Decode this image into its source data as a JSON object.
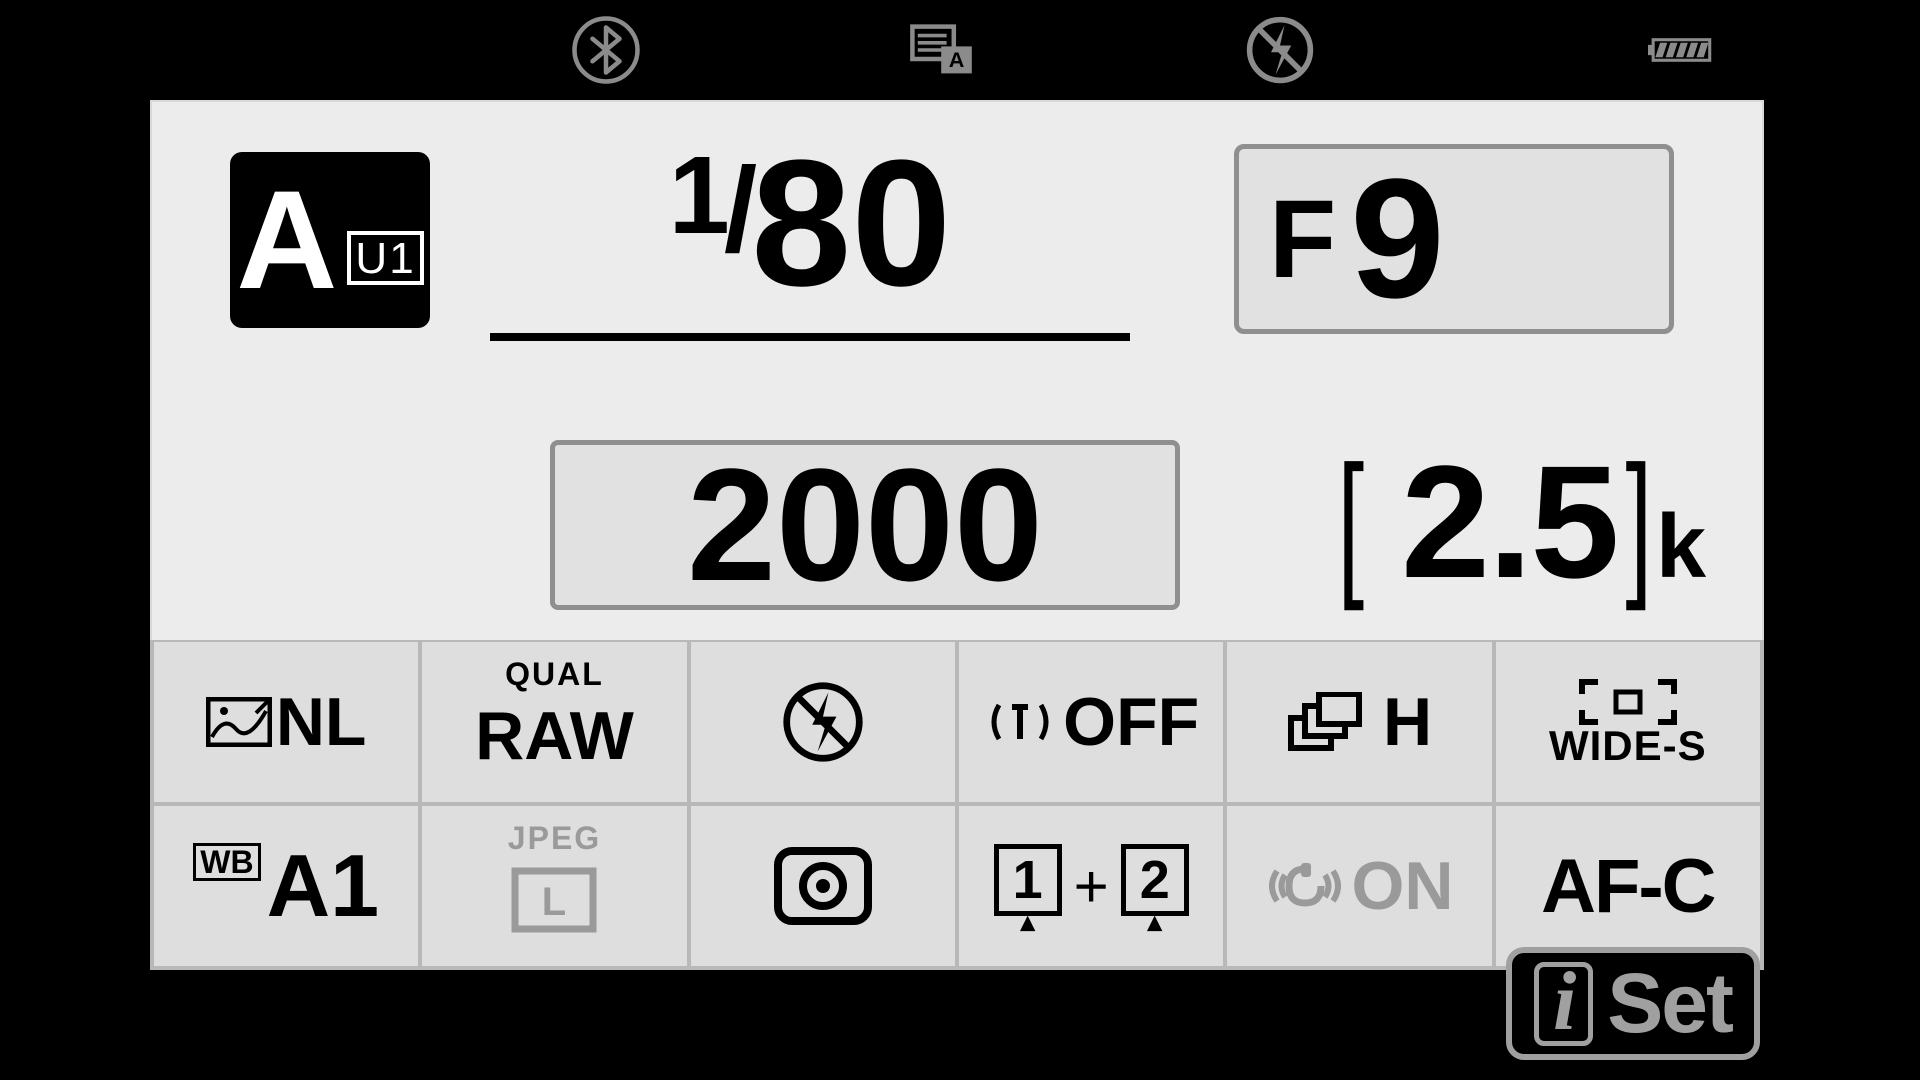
{
  "status": {
    "bluetooth": "on",
    "display_overlay": "A",
    "flash": "off",
    "battery_level": 5
  },
  "exposure": {
    "mode_letter": "A",
    "mode_sub": "U1",
    "shutter_numerator": "1",
    "shutter_denominator": "80",
    "aperture_prefix": "F",
    "aperture_value": "9",
    "iso_value": "2000",
    "remaining_value": "2.5",
    "remaining_unit": "k"
  },
  "tiles": {
    "picture_control": "NL",
    "qual_raw_top": "QUAL",
    "qual_raw": "RAW",
    "wireless_label": "OFF",
    "release_mode": "H",
    "af_area_label": "WIDE-S",
    "wb_value": "A1",
    "wb_prefix": "WB",
    "jpeg_top": "JPEG",
    "jpeg_size": "L",
    "slot_1": "1",
    "slot_2": "2",
    "vr_label": "ON",
    "focus_mode": "AF-C"
  },
  "button": {
    "i": "i",
    "set": "Set"
  }
}
